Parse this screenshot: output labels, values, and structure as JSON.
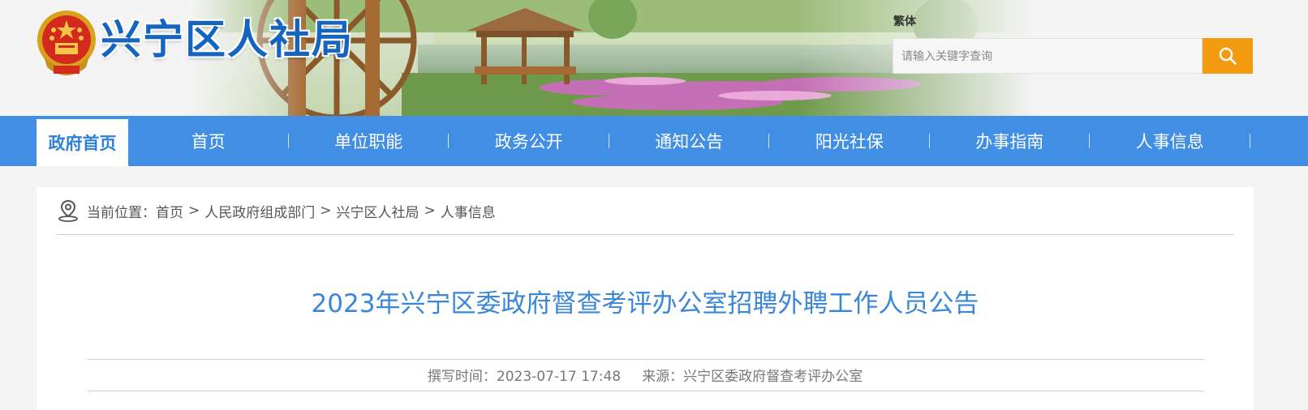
{
  "header": {
    "site_title": "兴宁区人社局",
    "traditional_link": "繁体",
    "search": {
      "placeholder": "请输入关键字查询",
      "value": ""
    }
  },
  "nav": {
    "home": "政府首页",
    "items": [
      "首页",
      "单位职能",
      "政务公开",
      "通知公告",
      "阳光社保",
      "办事指南",
      "人事信息"
    ]
  },
  "breadcrumb": {
    "prefix": "当前位置：",
    "items": [
      "首页",
      "人民政府组成部门",
      "兴宁区人社局",
      "人事信息"
    ],
    "separator": ">"
  },
  "article": {
    "title": "2023年兴宁区委政府督查考评办公室招聘外聘工作人员公告",
    "time_label": "撰写时间：",
    "time_value": "2023-07-17 17:48",
    "source_label": "来源：",
    "source_value": "兴宁区委政府督查考评办公室"
  },
  "icons": {
    "emblem": "national-emblem-icon",
    "search": "search-icon",
    "location": "location-pin-icon"
  },
  "colors": {
    "nav_blue": "#418ee5",
    "title_blue": "#1565c0",
    "article_title": "#3a86d8",
    "search_button": "#f39c12"
  }
}
